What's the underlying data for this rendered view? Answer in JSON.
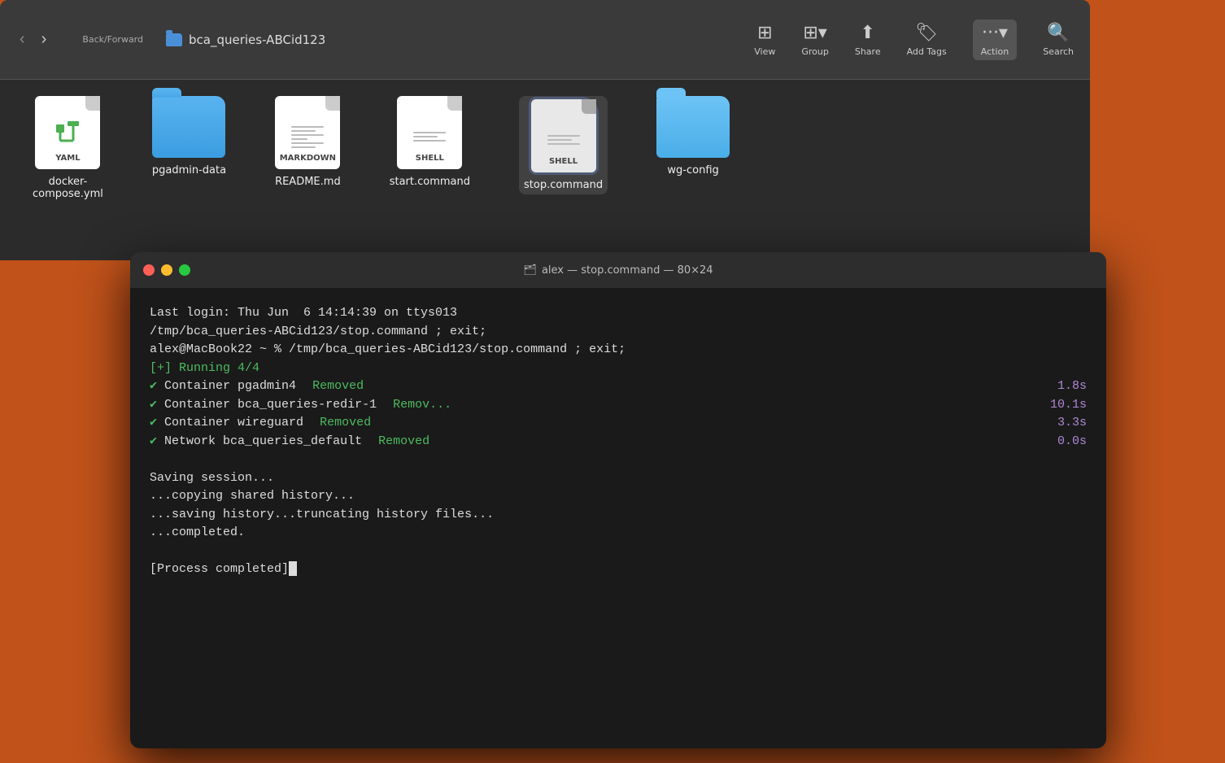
{
  "finder": {
    "title": "bca_queries-ABCid123",
    "toolbar": {
      "back_label": "‹",
      "forward_label": "›",
      "back_forward_label": "Back/Forward",
      "view_label": "View",
      "group_label": "Group",
      "share_label": "Share",
      "add_tags_label": "Add Tags",
      "action_label": "Action",
      "search_label": "Search"
    },
    "files": [
      {
        "id": "docker-compose",
        "name": "docker-compose.yml",
        "type": "yaml"
      },
      {
        "id": "pgadmin-data",
        "name": "pgadmin-data",
        "type": "folder"
      },
      {
        "id": "readme",
        "name": "README.md",
        "type": "markdown"
      },
      {
        "id": "start-command",
        "name": "start.command",
        "type": "shell"
      },
      {
        "id": "stop-command",
        "name": "stop.command",
        "type": "shell-selected"
      },
      {
        "id": "wg-config",
        "name": "wg-config",
        "type": "folder-light"
      }
    ]
  },
  "terminal": {
    "title": "alex — stop.command — 80×24",
    "lines": [
      {
        "text": "Last login: Thu Jun  6 14:14:39 on ttys013",
        "color": "white"
      },
      {
        "text": "/tmp/bca_queries-ABCid123/stop.command ; exit;",
        "color": "white"
      },
      {
        "text": "alex@MacBook22 ~ % /tmp/bca_queries-ABCid123/stop.command ; exit;",
        "color": "white"
      },
      {
        "text": "[+] Running 4/4",
        "color": "green"
      },
      {
        "text": " ✔ Container pgadmin4",
        "status": "Removed",
        "time": "1.8s",
        "color": "white"
      },
      {
        "text": " ✔ Container bca_queries-redir-1",
        "status": "Remov...",
        "time": "10.1s",
        "color": "white"
      },
      {
        "text": " ✔ Container wireguard",
        "status": "Removed",
        "time": "3.3s",
        "color": "white"
      },
      {
        "text": " ✔ Network bca_queries_default",
        "status": "Removed",
        "time": "0.0s",
        "color": "white"
      },
      {
        "text": "",
        "color": "white"
      },
      {
        "text": "Saving session...",
        "color": "white"
      },
      {
        "text": "...copying shared history...",
        "color": "white"
      },
      {
        "text": "...saving history...truncating history files...",
        "color": "white"
      },
      {
        "text": "...completed.",
        "color": "white"
      },
      {
        "text": "",
        "color": "white"
      },
      {
        "text": "[Process completed]",
        "color": "white",
        "cursor": true
      }
    ],
    "container_rows": [
      {
        "label": " ✔ Container pgadmin4",
        "status": "Removed",
        "time": "1.8s"
      },
      {
        "label": " ✔ Container bca_queries-redir-1",
        "status": "Remov...",
        "time": "10.1s"
      },
      {
        "label": " ✔ Container wireguard",
        "status": "Removed",
        "time": "3.3s"
      },
      {
        "label": " ✔ Network bca_queries_default",
        "status": "Removed",
        "time": "0.0s"
      }
    ]
  }
}
